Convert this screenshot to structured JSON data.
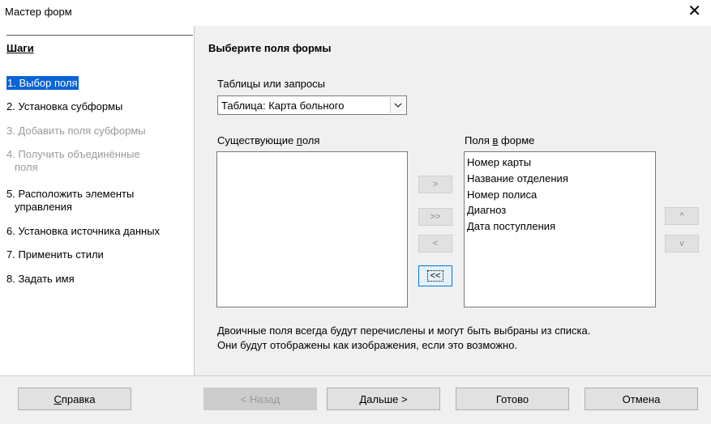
{
  "window": {
    "title": "Мастер форм",
    "close_icon": "✕"
  },
  "sidebar": {
    "heading": "Шаги",
    "items": [
      {
        "label": "1. Выбор поля",
        "state": "active"
      },
      {
        "label": "2. Установка субформы",
        "state": "enabled"
      },
      {
        "label": "3. Добавить поля субформы",
        "state": "disabled"
      },
      {
        "label": "4. Получить объединённые",
        "label2": "поля",
        "state": "disabled"
      },
      {
        "label": "5. Расположить элементы",
        "label2": "управления",
        "state": "enabled"
      },
      {
        "label": "6. Установка источника данных",
        "state": "enabled"
      },
      {
        "label": "7. Применить стили",
        "state": "enabled"
      },
      {
        "label": "8. Задать имя",
        "state": "enabled"
      }
    ]
  },
  "main": {
    "heading": "Выберите поля формы",
    "tables_label": "Таблицы или запросы",
    "tables_value": "Таблица: Карта больного",
    "existing_label_pre": "Существующие ",
    "existing_label_u": "п",
    "existing_label_post": "оля",
    "existing_fields": [],
    "form_label_pre": "Поля ",
    "form_label_u": "в",
    "form_label_post": " форме",
    "form_fields": [
      "Номер карты",
      "Название отделения",
      "Номер полиса",
      "Диагноз",
      "Дата поступления"
    ],
    "move_buttons": {
      "add": ">",
      "add_all": ">>",
      "remove": "<",
      "remove_all": "<<"
    },
    "order_buttons": {
      "up": "^",
      "down": "v"
    },
    "note_line1": "Двоичные поля всегда будут перечислены и могут быть выбраны из списка.",
    "note_line2": "Они будут отображены как изображения, если это возможно."
  },
  "footer": {
    "help_u": "С",
    "help_rest": "правка",
    "back": "< Назад",
    "next": "Дальше >",
    "finish": "Готово",
    "cancel": "Отмена"
  }
}
